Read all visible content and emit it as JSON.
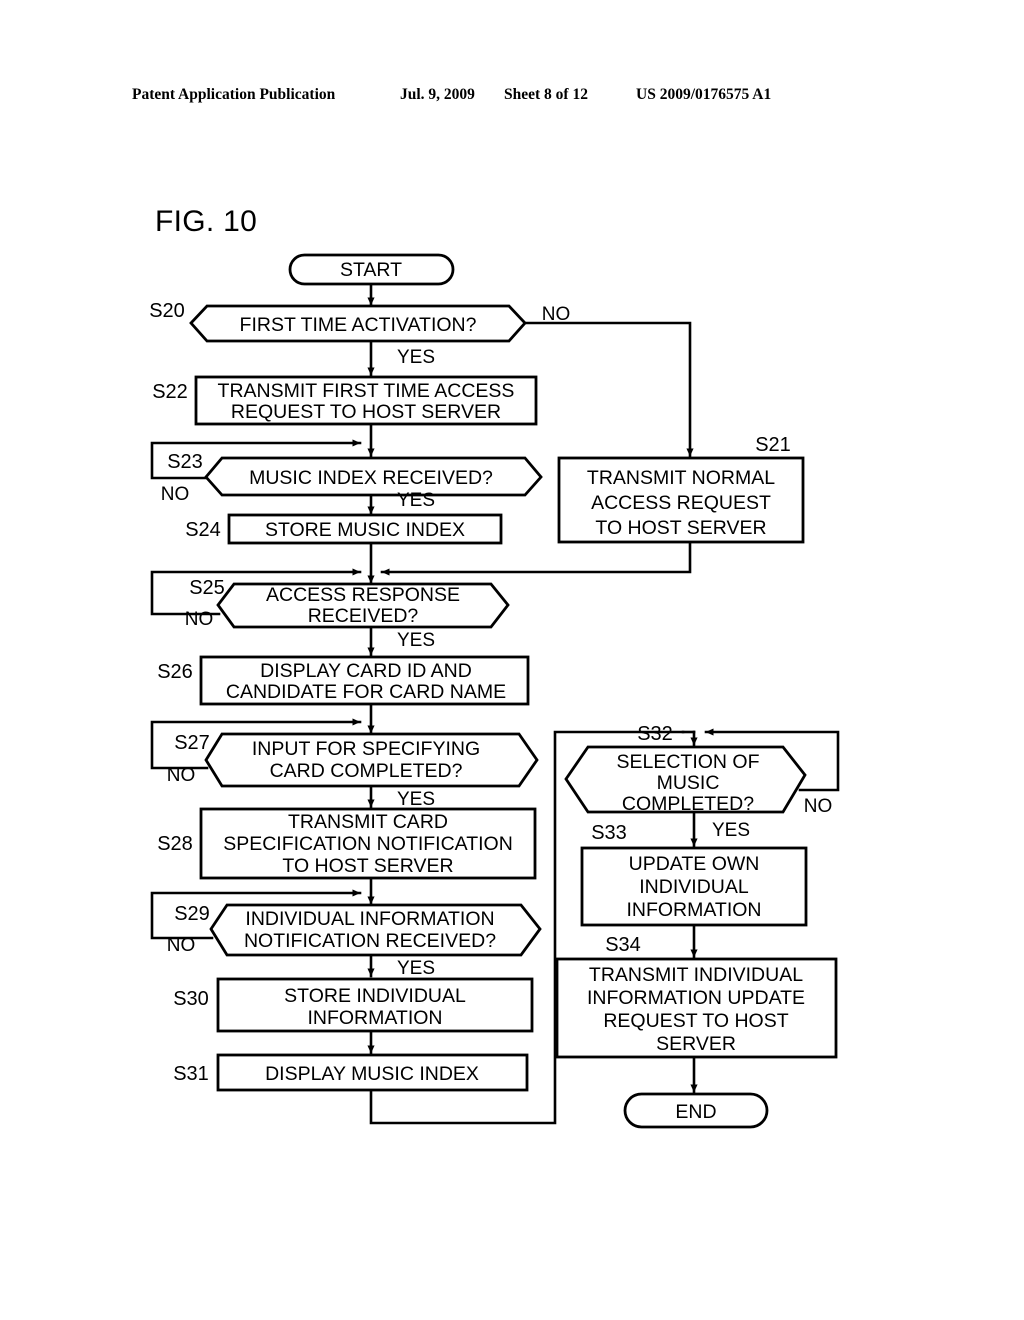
{
  "header": {
    "publication": "Patent Application Publication",
    "date": "Jul. 9, 2009",
    "sheet": "Sheet 8 of 12",
    "number": "US 2009/0176575 A1"
  },
  "figure": {
    "title": "FIG. 10",
    "type": "flowchart"
  },
  "terminals": {
    "start": "START",
    "end": "END"
  },
  "branch_labels": {
    "yes": "YES",
    "no": "NO"
  },
  "steps": {
    "s20": {
      "id": "S20",
      "shape": "decision",
      "text": "FIRST TIME ACTIVATION?"
    },
    "s21": {
      "id": "S21",
      "shape": "process",
      "line1": "TRANSMIT NORMAL",
      "line2": "ACCESS REQUEST",
      "line3": "TO HOST SERVER"
    },
    "s22": {
      "id": "S22",
      "shape": "process",
      "line1": "TRANSMIT FIRST TIME ACCESS",
      "line2": "REQUEST TO HOST SERVER"
    },
    "s23": {
      "id": "S23",
      "shape": "decision",
      "text": "MUSIC INDEX RECEIVED?"
    },
    "s24": {
      "id": "S24",
      "shape": "process",
      "line1": "STORE MUSIC INDEX"
    },
    "s25": {
      "id": "S25",
      "shape": "decision",
      "line1": "ACCESS RESPONSE",
      "line2": "RECEIVED?"
    },
    "s26": {
      "id": "S26",
      "shape": "process",
      "line1": "DISPLAY CARD ID AND",
      "line2": "CANDIDATE FOR CARD NAME"
    },
    "s27": {
      "id": "S27",
      "shape": "decision",
      "line1": "INPUT FOR SPECIFYING",
      "line2": "CARD COMPLETED?"
    },
    "s28": {
      "id": "S28",
      "shape": "process",
      "line1": "TRANSMIT CARD",
      "line2": "SPECIFICATION NOTIFICATION",
      "line3": "TO HOST SERVER"
    },
    "s29": {
      "id": "S29",
      "shape": "decision",
      "line1": "INDIVIDUAL INFORMATION",
      "line2": "NOTIFICATION RECEIVED?"
    },
    "s30": {
      "id": "S30",
      "shape": "process",
      "line1": "STORE INDIVIDUAL",
      "line2": "INFORMATION"
    },
    "s31": {
      "id": "S31",
      "shape": "process",
      "line1": "DISPLAY MUSIC INDEX"
    },
    "s32": {
      "id": "S32",
      "shape": "decision",
      "line1": "SELECTION OF",
      "line2": "MUSIC",
      "line3": "COMPLETED?"
    },
    "s33": {
      "id": "S33",
      "shape": "process",
      "line1": "UPDATE OWN",
      "line2": "INDIVIDUAL",
      "line3": "INFORMATION"
    },
    "s34": {
      "id": "S34",
      "shape": "process",
      "line1": "TRANSMIT INDIVIDUAL",
      "line2": "INFORMATION UPDATE",
      "line3": "REQUEST TO HOST",
      "line4": "SERVER"
    }
  }
}
